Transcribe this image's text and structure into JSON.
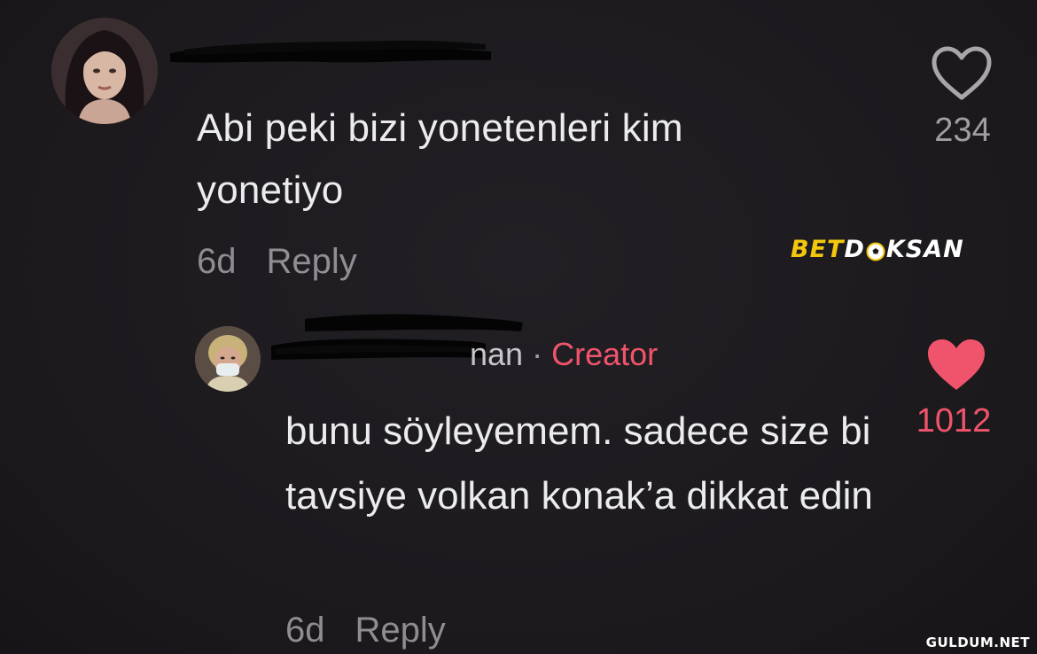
{
  "comment": {
    "text": "Abi peki bizi yonetenleri kim yonetiyo",
    "time": "6d",
    "reply_label": "Reply",
    "likes": "234",
    "like_icon": "heart-outline-icon"
  },
  "reply": {
    "author_suffix": "nan",
    "separator": "·",
    "role_badge": "Creator",
    "text": "bunu söyleyemem. sadece size bi tavsiye volkan konak’a dikkat edin",
    "time": "6d",
    "reply_label": "Reply",
    "likes": "1012",
    "like_icon": "heart-filled-icon"
  },
  "watermarks": {
    "brand_part1": "BET",
    "brand_part2_a": "D",
    "brand_part2_b": "KSAN",
    "site": "GULDUM.NET"
  },
  "colors": {
    "background": "#1c1a1d",
    "text": "#ecebee",
    "muted": "#8f8c92",
    "accent": "#f0546c",
    "brand_yellow": "#f4c70f"
  }
}
